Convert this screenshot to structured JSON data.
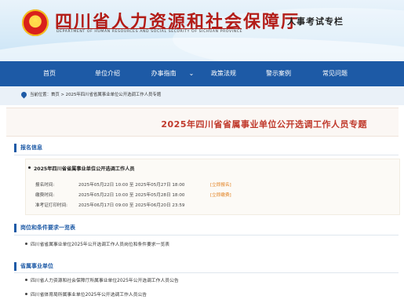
{
  "header": {
    "title": "四川省人力资源和社会保障厅",
    "subtitle": "DEPARTMENT OF HUMAN RESOURCES AND SOCIAL SECURITY OF SICHUAN PROVINCE",
    "special_column": "人事考试专栏"
  },
  "nav": {
    "items": [
      {
        "label": "首页"
      },
      {
        "label": "单位介绍"
      },
      {
        "label": "办事指南"
      },
      {
        "label": "政策法规"
      },
      {
        "label": "警示案例"
      },
      {
        "label": "常见问题"
      }
    ],
    "dropdown_chevron": "⌄"
  },
  "breadcrumb": {
    "text": "当前位置：首页 > 2025年四川省省属事业单位公开选调工作人员专题"
  },
  "topic": {
    "title": "2025年四川省省属事业单位公开选调工作人员专题"
  },
  "signup": {
    "section_title": "报名信息",
    "item_title": "2025年四川省省属事业单位公开选调工作人员",
    "rows": [
      {
        "key": "报名时间:",
        "value": "2025年05月22日 10:00 至 2025年05月27日 18:00",
        "link": "[立即报名]"
      },
      {
        "key": "缴费时间:",
        "value": "2025年05月22日 10:00 至 2025年05月28日 18:00",
        "link": "[立即缴费]"
      },
      {
        "key": "准考证打印时间:",
        "value": "2025年06月17日 09:00 至 2025年06月20日 23:59",
        "link": ""
      }
    ]
  },
  "positions": {
    "section_title": "岗位和条件要求一览表",
    "items": [
      "四川省省属事业单位2025年公开选调工作人员岗位和条件要求一览表"
    ]
  },
  "units": {
    "section_title": "省属事业单位",
    "items": [
      "四川省人力资源和社会保障厅所属事业单位2025年公开选调工作人员公告",
      "四川省体育局所属事业单位2025年公开选调工作人员公告"
    ]
  },
  "colors": {
    "nav_blue": "#1d5aa6",
    "title_red": "#b31c17",
    "link_orange": "#e07d1a"
  }
}
